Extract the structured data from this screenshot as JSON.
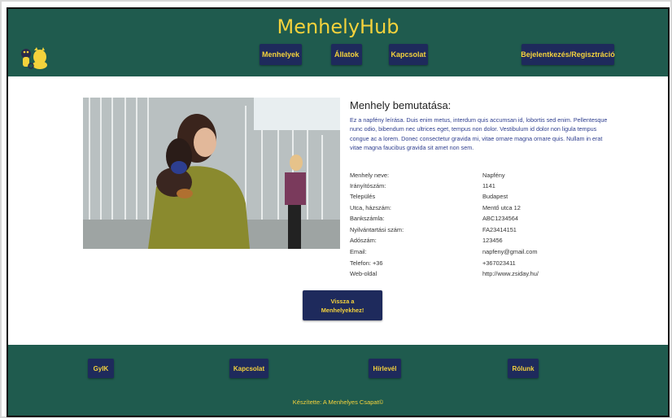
{
  "header": {
    "brand": "MenhelyHub",
    "nav": {
      "shelters": "Menhelyek",
      "animals": "Állatok",
      "contact": "Kapcsolat",
      "auth": "Bejelentkezés/Regisztráció"
    }
  },
  "main": {
    "title": "Menhely bemutatása:",
    "description": "Ez a napfény leírása. Duis enim metus, interdum quis accumsan id, lobortis sed enim. Pellentesque nunc odio, bibendum nec ultrices eget, tempus non dolor. Vestibulum id dolor non ligula tempus congue ac a lorem. Donec consectetur gravida mi, vitae ornare magna ornare quis. Nullam in erat vitae magna faucibus gravida sit amet non sem.",
    "info": [
      {
        "label": "Menhely neve:",
        "value": "Napfény"
      },
      {
        "label": "Irányítószám:",
        "value": "1141"
      },
      {
        "label": "Település",
        "value": "Budapest"
      },
      {
        "label": "Utca, házszám:",
        "value": "Mentő utca 12"
      },
      {
        "label": "Bankszámla:",
        "value": "ABC1234564"
      },
      {
        "label": "Nyilvántartási szám:",
        "value": "FA23414151"
      },
      {
        "label": "Adószám:",
        "value": "123456"
      },
      {
        "label": "Email:",
        "value": "napfeny@gmail.com"
      },
      {
        "label": "Telefon: +36",
        "value": "+367023411"
      },
      {
        "label": "Web-oldal",
        "value": "http://www.zsiday.hu/"
      }
    ],
    "back_line1": "Vissza a",
    "back_line2": "Menhelyekhez!"
  },
  "footer": {
    "faq": "GyIK",
    "contact": "Kapcsolat",
    "newsletter": "Hírlevél",
    "about": "Rólunk",
    "credit": "Készítette: A Menhelyes Csapat©"
  },
  "colors": {
    "header_bg": "#1f5b4e",
    "button_bg": "#1e2a5c",
    "accent": "#f4d23c"
  }
}
